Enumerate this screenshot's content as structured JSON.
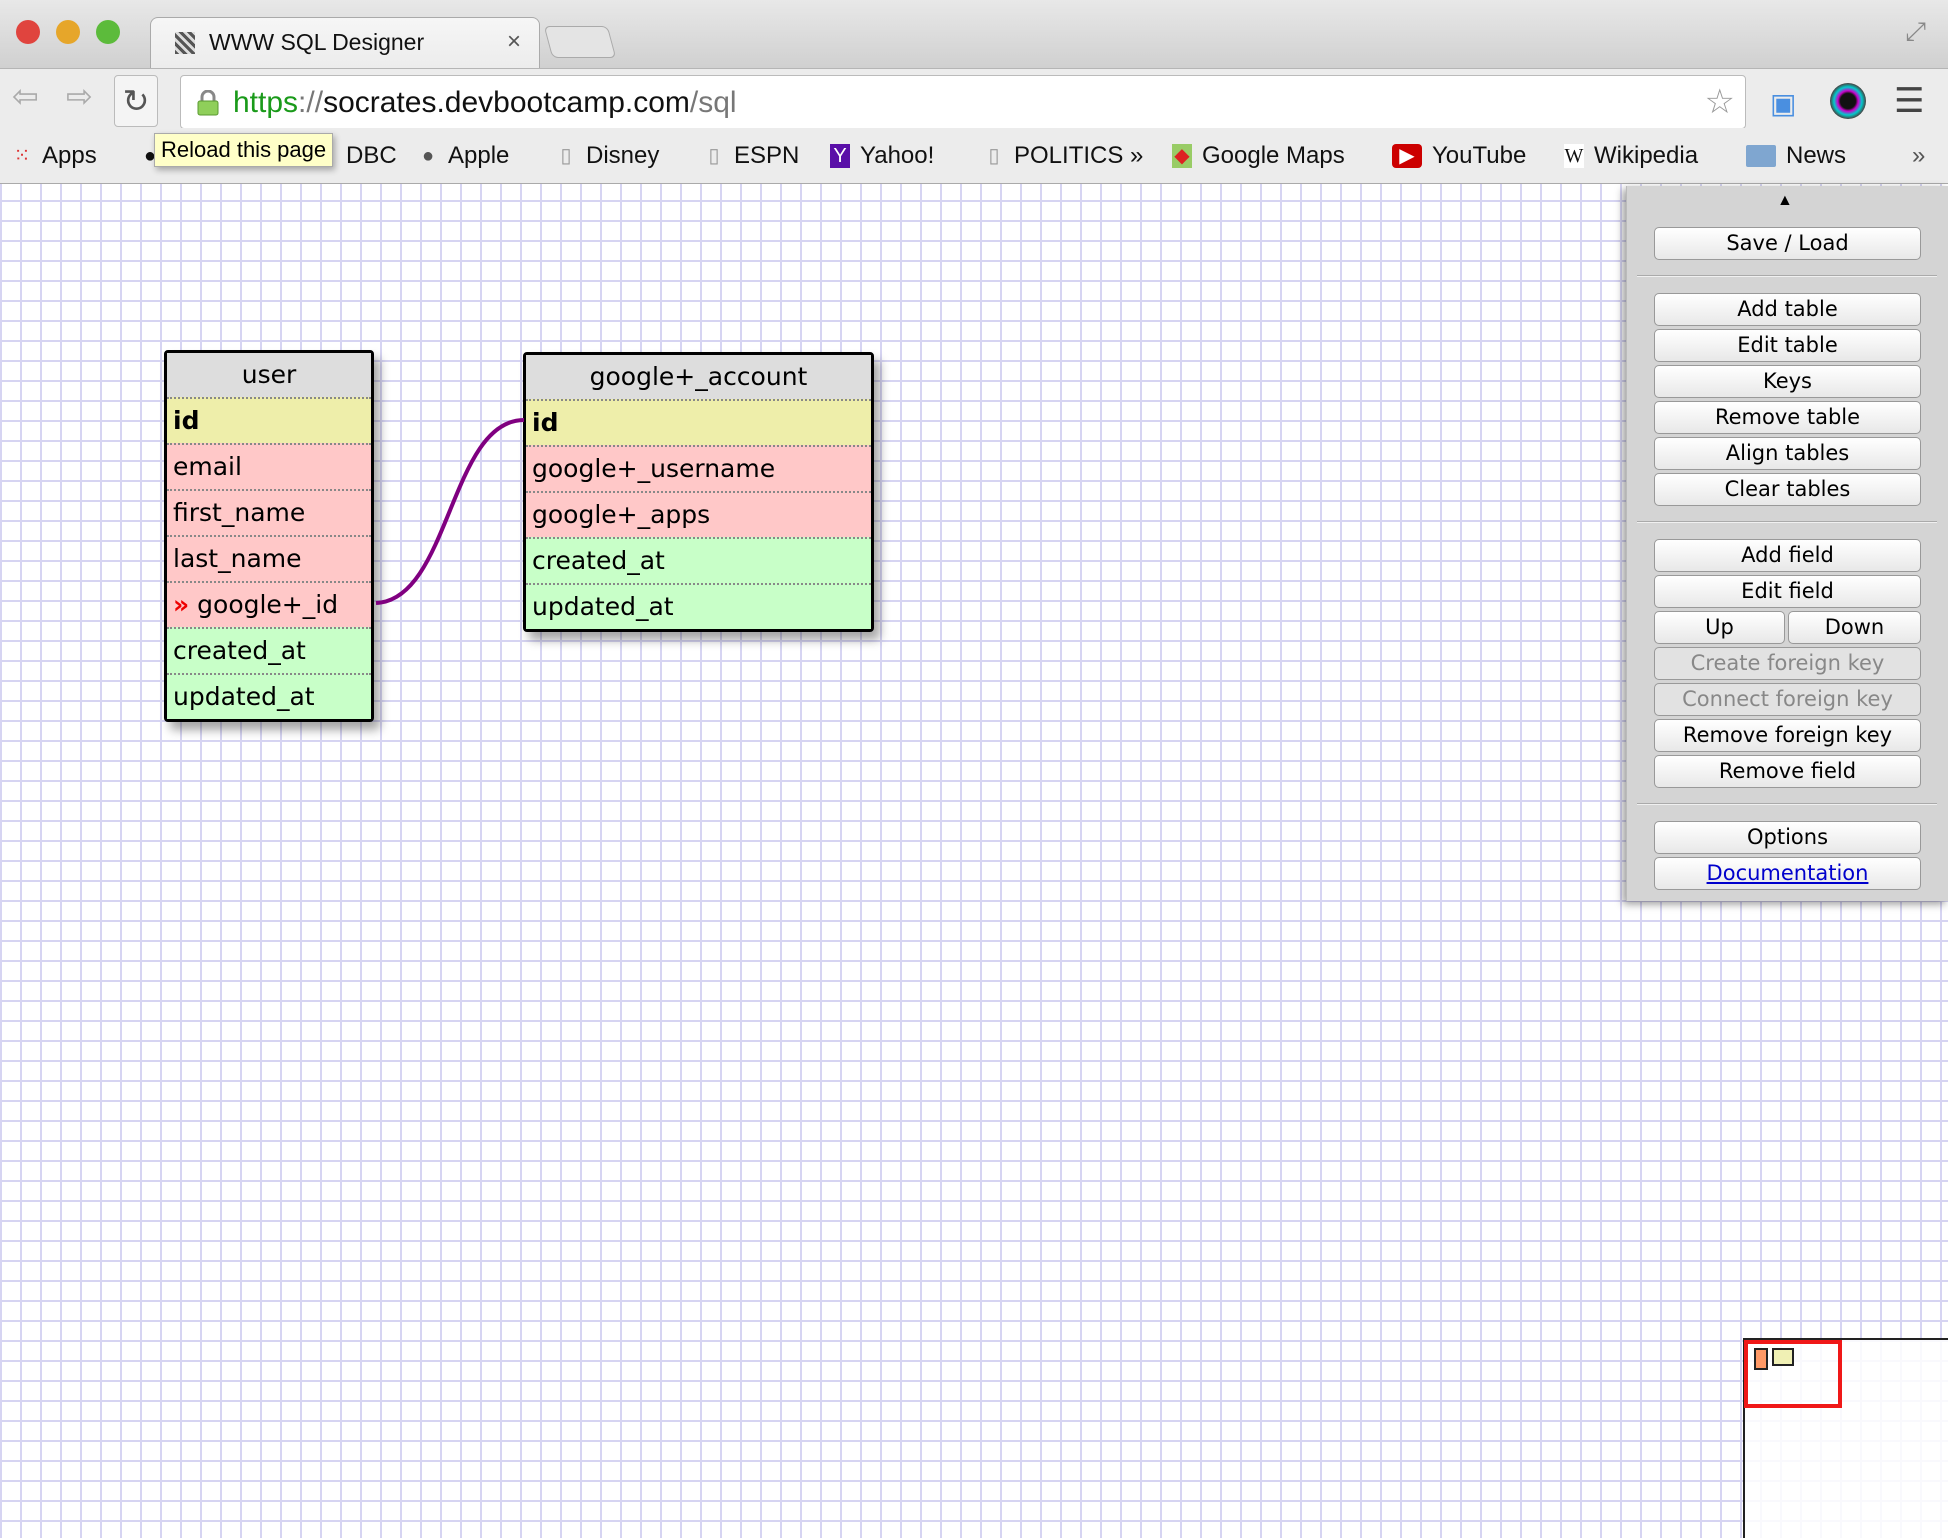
{
  "browser": {
    "tab_title": "WWW SQL Designer",
    "tab_close": "×",
    "url_scheme": "https",
    "url_sep": "://",
    "url_host": "socrates.devbootcamp.com",
    "url_path": "/sql",
    "tooltip": "Reload this page",
    "bookmarks": [
      {
        "label": "Apps",
        "icon": "apps-grid-icon"
      },
      {
        "label": "DBC",
        "icon": "github-icon"
      },
      {
        "label": "Apple",
        "icon": "apple-icon"
      },
      {
        "label": "Disney",
        "icon": "page-icon"
      },
      {
        "label": "ESPN",
        "icon": "page-icon"
      },
      {
        "label": "Yahoo!",
        "icon": "yahoo-icon"
      },
      {
        "label": "POLITICS »",
        "icon": "page-icon"
      },
      {
        "label": "Google Maps",
        "icon": "maps-icon"
      },
      {
        "label": "YouTube",
        "icon": "youtube-icon"
      },
      {
        "label": "Wikipedia",
        "icon": "wikipedia-icon"
      },
      {
        "label": "News",
        "icon": "folder-icon"
      }
    ],
    "overflow": "»"
  },
  "tables": [
    {
      "name": "user",
      "fields": [
        {
          "name": "id",
          "kind": "primary"
        },
        {
          "name": "email",
          "kind": "not-null"
        },
        {
          "name": "first_name",
          "kind": "not-null"
        },
        {
          "name": "last_name",
          "kind": "not-null"
        },
        {
          "name": "google+_id",
          "kind": "not-null",
          "fk_marker": "»"
        },
        {
          "name": "created_at",
          "kind": "nullable"
        },
        {
          "name": "updated_at",
          "kind": "nullable"
        }
      ]
    },
    {
      "name": "google+_account",
      "fields": [
        {
          "name": "id",
          "kind": "primary"
        },
        {
          "name": "google+_username",
          "kind": "not-null"
        },
        {
          "name": "google+_apps",
          "kind": "not-null"
        },
        {
          "name": "created_at",
          "kind": "nullable"
        },
        {
          "name": "updated_at",
          "kind": "nullable"
        }
      ]
    }
  ],
  "relation": {
    "from": "user.google+_id",
    "to": "google+_account.id",
    "color": "#800080"
  },
  "sidebar": {
    "save_load": "Save / Load",
    "add_table": "Add table",
    "edit_table": "Edit table",
    "keys": "Keys",
    "remove_table": "Remove table",
    "align_tables": "Align tables",
    "clear_tables": "Clear tables",
    "add_field": "Add field",
    "edit_field": "Edit field",
    "up": "Up",
    "down": "Down",
    "create_fk": "Create foreign key",
    "connect_fk": "Connect foreign key",
    "remove_fk": "Remove foreign key",
    "remove_field": "Remove field",
    "options": "Options",
    "documentation": "Documentation"
  },
  "colors": {
    "primary": "#eeeeaa",
    "not_null": "#ffc8c8",
    "nullable": "#c8ffc8",
    "viewport": "#f01818"
  }
}
